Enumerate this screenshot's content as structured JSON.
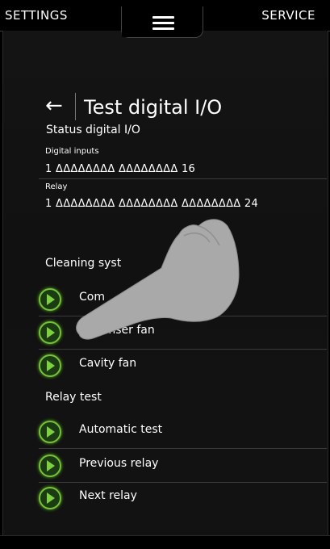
{
  "header": {
    "settings_label": "SETTINGS",
    "service_label": "SERVICE"
  },
  "page": {
    "title": "Test digital I/O"
  },
  "status": {
    "title": "Status digital I/O",
    "digital_inputs_label": "Digital inputs",
    "digital_inputs_value": "1 ΔΔΔΔΔΔΔΔ ΔΔΔΔΔΔΔΔ 16",
    "relay_label": "Relay",
    "relay_value": "1 ΔΔΔΔΔΔΔΔ ΔΔΔΔΔΔΔΔ ΔΔΔΔΔΔΔΔ 24"
  },
  "cleaning": {
    "title": "Cleaning syst",
    "items": [
      {
        "label": "Com"
      },
      {
        "label": "ndenser fan"
      },
      {
        "label": "Cavity fan"
      }
    ]
  },
  "relay_test": {
    "title": "Relay test",
    "items": [
      {
        "label": "Automatic test"
      },
      {
        "label": "Previous relay"
      },
      {
        "label": "Next relay"
      }
    ]
  },
  "colors": {
    "background": "#000000",
    "panel": "#131313",
    "play_green": "#6fc72a",
    "overlay_hand": "#aaaaaa"
  },
  "icons": {
    "menu": "hamburger-menu-icon",
    "back": "back-arrow-icon",
    "play": "play-button-icon",
    "overlay": "pointing-hand-icon"
  }
}
